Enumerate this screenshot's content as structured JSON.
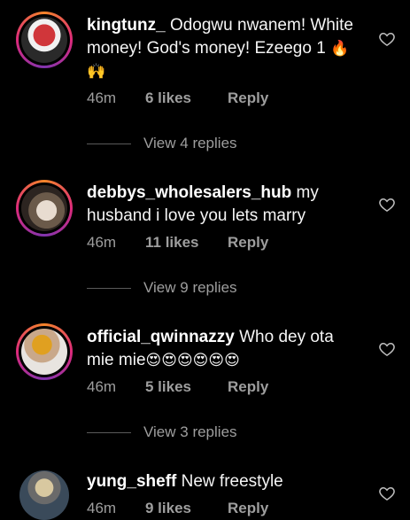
{
  "comments": [
    {
      "username": "kingtunz_",
      "text": "Odogwu nwanem! White money! God's money! Ezeego 1",
      "emoji": "🔥🙌",
      "time": "46m",
      "likes": "6 likes",
      "reply_label": "Reply",
      "view_replies": "View 4 replies"
    },
    {
      "username": "debbys_wholesalers_hub",
      "text": "my husband i love you lets marry",
      "emoji": "",
      "time": "46m",
      "likes": "11 likes",
      "reply_label": "Reply",
      "view_replies": "View 9 replies"
    },
    {
      "username": "official_qwinnazzy",
      "text": "Who dey ota mie mie",
      "emoji": "😍😍😍😍😍😍",
      "time": "46m",
      "likes": "5 likes",
      "reply_label": "Reply",
      "view_replies": "View 3 replies"
    },
    {
      "username": "yung_sheff",
      "text": "New freestyle",
      "emoji": "",
      "time": "46m",
      "likes": "9 likes",
      "reply_label": "Reply"
    }
  ],
  "icons": {
    "like": "heart-outline-icon"
  },
  "colors": {
    "background": "#000000",
    "meta_text": "#9e9e9e",
    "story_ring": [
      "#f58529",
      "#dd2a7b",
      "#8134af"
    ]
  }
}
